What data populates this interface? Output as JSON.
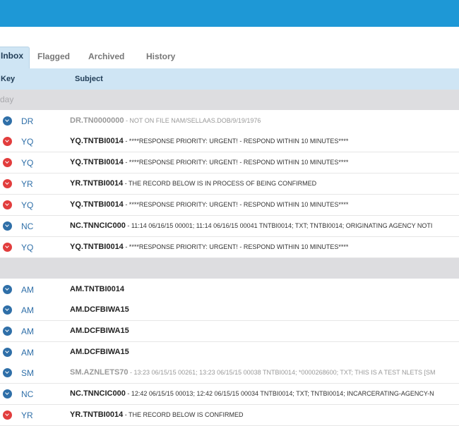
{
  "tabs": [
    {
      "label": "Inbox",
      "active": true
    },
    {
      "label": "Flagged",
      "active": false
    },
    {
      "label": "Archived",
      "active": false
    },
    {
      "label": "History",
      "active": false
    }
  ],
  "columns": {
    "key": "Key",
    "subject": "Subject"
  },
  "groups": [
    {
      "label": "rday"
    },
    {
      "label": ""
    }
  ],
  "colors": {
    "accent": "#1e98d6",
    "header": "#cfe5f4",
    "red": "#e23d3d",
    "blue": "#2f6fa8"
  },
  "messages": [
    {
      "icon": "download-circle-icon",
      "color": "blue",
      "key": "DR",
      "from": "DR.TN0000000",
      "text": " - NOT ON FILE NAM/SELLAAS.DOB/9/19/1976",
      "read": true
    },
    {
      "icon": "download-circle-icon",
      "color": "red",
      "key": "YQ",
      "from": "YQ.TNTBI0014",
      "text": " - ****RESPONSE PRIORITY: URGENT! - RESPOND WITHIN 10 MINUTES****",
      "read": false
    },
    {
      "icon": "download-circle-icon",
      "color": "red",
      "key": "YQ",
      "from": "YQ.TNTBI0014",
      "text": " - ****RESPONSE PRIORITY: URGENT! - RESPOND WITHIN 10 MINUTES****",
      "read": false
    },
    {
      "icon": "download-circle-icon",
      "color": "red",
      "key": "YR",
      "from": "YR.TNTBI0014",
      "text": " - THE RECORD BELOW IS IN PROCESS OF BEING CONFIRMED",
      "read": false
    },
    {
      "icon": "download-circle-icon",
      "color": "red",
      "key": "YQ",
      "from": "YQ.TNTBI0014",
      "text": " - ****RESPONSE PRIORITY: URGENT! - RESPOND WITHIN 10 MINUTES****",
      "read": false
    },
    {
      "icon": "download-circle-icon",
      "color": "blue",
      "key": "NC",
      "from": "NC.TNNCIC000",
      "text": " - 11:14 06/16/15 00001; 11:14 06/16/15 00041 TNTBI0014; TXT; TNTBI0014; ORIGINATING AGENCY NOTI",
      "read": false
    },
    {
      "icon": "download-circle-icon",
      "color": "red",
      "key": "YQ",
      "from": "YQ.TNTBI0014",
      "text": " - ****RESPONSE PRIORITY: URGENT! - RESPOND WITHIN 10 MINUTES****",
      "read": false
    },
    {
      "icon": "download-circle-icon",
      "color": "blue",
      "key": "AM",
      "from": "AM.TNTBI0014",
      "text": "",
      "read": false
    },
    {
      "icon": "download-circle-icon",
      "color": "blue",
      "key": "AM",
      "from": "AM.DCFBIWA15",
      "text": "",
      "read": false
    },
    {
      "icon": "download-circle-icon",
      "color": "blue",
      "key": "AM",
      "from": "AM.DCFBIWA15",
      "text": "",
      "read": false
    },
    {
      "icon": "download-circle-icon",
      "color": "blue",
      "key": "AM",
      "from": "AM.DCFBIWA15",
      "text": "",
      "read": false
    },
    {
      "icon": "download-circle-icon",
      "color": "blue",
      "key": "SM",
      "from": "SM.AZNLETS70",
      "text": " - 13:23 06/15/15 00261; 13:23 06/15/15 00038 TNTBI0014; *0000268600; TXT; THIS IS A TEST NLETS [SM",
      "read": true
    },
    {
      "icon": "download-circle-icon",
      "color": "blue",
      "key": "NC",
      "from": "NC.TNNCIC000",
      "text": " - 12:42 06/15/15 00013; 12:42 06/15/15 00034 TNTBI0014; TXT; TNTBI0014; INCARCERATING-AGENCY-N",
      "read": false
    },
    {
      "icon": "download-circle-icon",
      "color": "red",
      "key": "YR",
      "from": "YR.TNTBI0014",
      "text": " - THE RECORD BELOW IS CONFIRMED",
      "read": false
    }
  ]
}
